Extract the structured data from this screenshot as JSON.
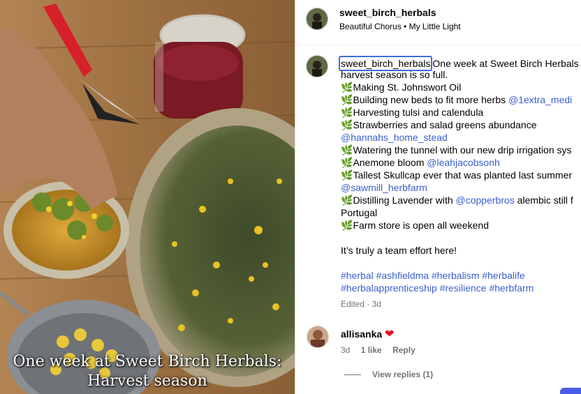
{
  "post": {
    "overlay_line1": "One week at Sweet Birch Herbals:",
    "overlay_line2": "Harvest season"
  },
  "header": {
    "username": "sweet_birch_herbals",
    "audio": "Beautiful Chorus • My Little Light"
  },
  "caption": {
    "username": "sweet_birch_herbals",
    "line1_rest": "One week at Sweet Birch Herbals",
    "line2": "harvest season is so full.",
    "item1": "Making St. Johnswort Oil",
    "item2": "Building new beds to fit more herbs ",
    "item2_mention": "@1extra_medi",
    "item3": "Harvesting tulsi and calendula",
    "item4": "Strawberries and salad greens abundance",
    "mention_hannah": "@hannahs_home_stead",
    "item5": "Watering the tunnel with our new drip irrigation sys",
    "item6": "Anemone bloom ",
    "item6_mention": "@leahjacobsonh",
    "item7": "Tallest Skullcap ever that was planted last summer",
    "mention_sawmill": "@sawmill_herbfarm",
    "item8": "Distilling Lavender with ",
    "item8_mention": "@copperbros",
    "item8_rest": " alembic still f",
    "item8_line2": "Portugal",
    "item9": "Farm store is open all weekend",
    "closing": "It’s truly a team effort here!",
    "hashtags_line1": "#herbal #ashfieldma #herbalism #herbalife",
    "hashtags_line2": "#herbalapprenticeship #resilience #herbfarm",
    "edited": "Edited · 3d",
    "leaf": "🌿"
  },
  "comment": {
    "username": "allisanka",
    "heart": "❤",
    "age": "3d",
    "likes": "1 like",
    "reply": "Reply",
    "view_replies": "View replies (1)"
  },
  "colors": {
    "link": "#3b5fcf",
    "heart": "#e0101f",
    "accent_button": "#4a5de8"
  }
}
